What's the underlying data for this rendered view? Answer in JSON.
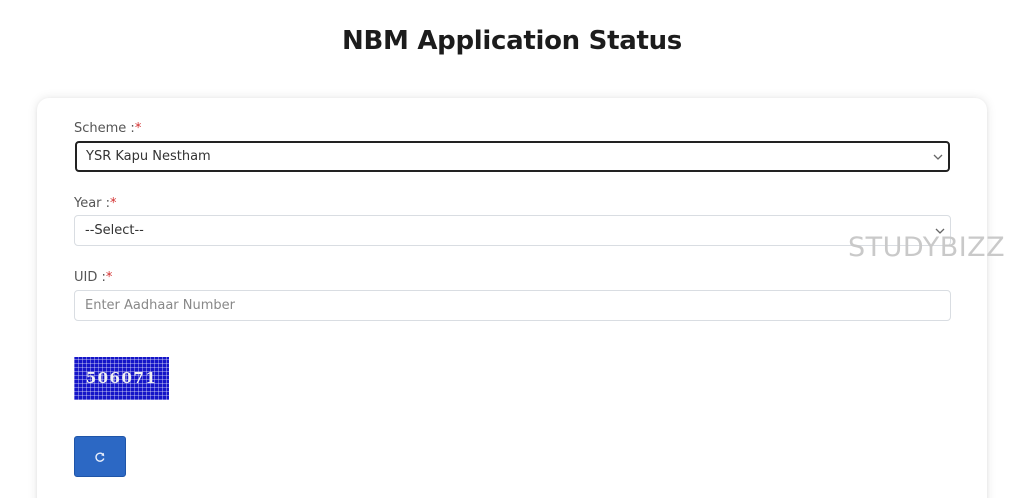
{
  "page": {
    "title": "NBM Application Status"
  },
  "form": {
    "scheme": {
      "label": "Scheme :",
      "required_mark": "*",
      "value": "YSR Kapu Nestham"
    },
    "year": {
      "label": "Year :",
      "required_mark": "*",
      "value": "--Select--"
    },
    "uid": {
      "label": "UID :",
      "required_mark": "*",
      "placeholder": "Enter Aadhaar Number"
    },
    "captcha": {
      "code": "506071"
    },
    "refresh": {
      "icon": "refresh-icon"
    }
  },
  "watermark": {
    "text": "STUDYBIZZ"
  },
  "colors": {
    "button": "#2c68c4",
    "captcha_bg": "#1515c8",
    "required": "#d32f2f"
  }
}
